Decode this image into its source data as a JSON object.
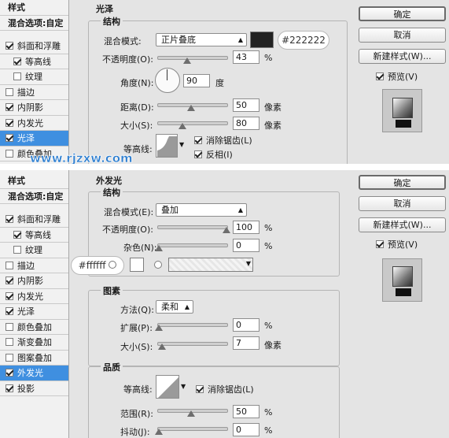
{
  "watermark": "www.rjzxw.com",
  "dialog1": {
    "sidebar": {
      "title": "样式",
      "blend_options": "混合选项:自定",
      "items": [
        {
          "label": "斜面和浮雕",
          "checked": true
        },
        {
          "label": "等高线",
          "checked": true
        },
        {
          "label": "纹理",
          "checked": false
        },
        {
          "label": "描边",
          "checked": false
        },
        {
          "label": "内阴影",
          "checked": true
        },
        {
          "label": "内发光",
          "checked": true
        },
        {
          "label": "光泽",
          "checked": true
        },
        {
          "label": "颜色叠加",
          "checked": false
        }
      ]
    },
    "section_title": "光泽",
    "group_title": "结构",
    "blend_mode_label": "混合模式:",
    "blend_mode_value": "正片叠底",
    "color_hex": "#222222",
    "opacity_label": "不透明度(O):",
    "opacity_value": "43",
    "angle_label": "角度(N):",
    "angle_value": "90",
    "angle_unit": "度",
    "distance_label": "距离(D):",
    "distance_value": "50",
    "size_label": "大小(S):",
    "size_value": "80",
    "contour_label": "等高线:",
    "anti_alias_label": "消除锯齿(L)",
    "invert_label": "反相(I)",
    "unit_percent": "%",
    "unit_px": "像素",
    "buttons": {
      "ok": "确定",
      "cancel": "取消",
      "new_style": "新建样式(W)...",
      "preview": "预览(V)"
    }
  },
  "dialog2": {
    "sidebar": {
      "title": "样式",
      "blend_options": "混合选项:自定",
      "items": [
        {
          "label": "斜面和浮雕",
          "checked": true
        },
        {
          "label": "等高线",
          "checked": true
        },
        {
          "label": "纹理",
          "checked": false
        },
        {
          "label": "描边",
          "checked": false
        },
        {
          "label": "内阴影",
          "checked": true
        },
        {
          "label": "内发光",
          "checked": true
        },
        {
          "label": "光泽",
          "checked": true
        },
        {
          "label": "颜色叠加",
          "checked": false
        },
        {
          "label": "渐变叠加",
          "checked": false
        },
        {
          "label": "图案叠加",
          "checked": false
        },
        {
          "label": "外发光",
          "checked": true
        },
        {
          "label": "投影",
          "checked": true
        }
      ]
    },
    "section_title": "外发光",
    "group_structure": "结构",
    "blend_mode_label": "混合模式(E):",
    "blend_mode_value": "叠加",
    "opacity_label": "不透明度(O):",
    "opacity_value": "100",
    "noise_label": "杂色(N):",
    "noise_value": "0",
    "color_hex": "#ffffff",
    "group_elements": "图素",
    "method_label": "方法(Q):",
    "method_value": "柔和",
    "spread_label": "扩展(P):",
    "spread_value": "0",
    "size_label": "大小(S):",
    "size_value": "7",
    "group_quality": "品质",
    "contour_label": "等高线:",
    "anti_alias_label": "消除锯齿(L)",
    "range_label": "范围(R):",
    "range_value": "50",
    "jitter_label": "抖动(J):",
    "jitter_value": "0",
    "unit_percent": "%",
    "unit_px": "像素",
    "buttons": {
      "ok": "确定",
      "cancel": "取消",
      "new_style": "新建样式(W)...",
      "preview": "预览(V)"
    }
  }
}
